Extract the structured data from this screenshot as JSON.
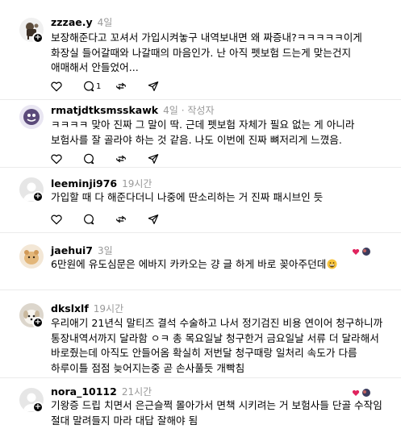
{
  "posts": [
    {
      "username": "zzzae.y",
      "time": "4일",
      "subtitle": "",
      "text": "보장해준다고 꼬셔서 가입시켜놓구 내역보내면 왜 짜증내?ㅋㅋㅋㅋㅋ이게 화장실 들어갈때와 나갈때의 마음인가. 난 아직 펫보험 드는게 맞는건지 애매해서 안들었어...",
      "reply_count": "1"
    },
    {
      "username": "rmatjdtksmsskawk",
      "time": "4일",
      "subtitle": "· 작성자",
      "text": "ㅋㅋㅋㅋ 맞아 진짜 그 말이 딱. 근데 펫보험 자체가 필요 없는 게 아니라 보험사를 잘 골라야 하는 것 같음. 나도 이번에 진짜 뼈저리게 느꼈음.",
      "reply_count": ""
    },
    {
      "username": "leeminji976",
      "time": "19시간",
      "subtitle": "",
      "text": "가입할 때 다 해준다더니 나중에 딴소리하는 거 진짜 패시브인 듯",
      "reply_count": ""
    },
    {
      "username": "jaehui7",
      "time": "3일",
      "subtitle": "",
      "text": "6만원에 유도심문은 에바지 카카오는 걍 글 하게 바로 꽂아주던데",
      "reply_count": ""
    },
    {
      "username": "dkslxlf",
      "time": "19시간",
      "subtitle": "",
      "text": "우리애기 21년식 말티즈 결석 수술하고 나서 정기검진 비용 연이어 청구하니까 통장내역서까지 달라함 ㅇㅋ 총 목요일날 청구한거 금요일날 서류 더 달라해서 바로줬는데 아직도 안들어옴 확실히 저번달 청구때랑 일처리 속도가 다름 하루이틀 점점 늦어지는중 곧 손사풀듯 개빡침",
      "reply_count": ""
    },
    {
      "username": "nora_10112",
      "time": "21시간",
      "subtitle": "",
      "text": "기왕증 드립 치면서 은근슬쩍 몰아가서 면책 시키려는 거 보험사들 단골 수작임 절대 말려들지 마라 대답 잘해야 됨",
      "reply_count": ""
    }
  ],
  "colors": {
    "text": "#000000",
    "muted": "#999999",
    "divider": "#ebebeb"
  },
  "icons": [
    "heart-icon",
    "comment-icon",
    "repost-icon",
    "share-icon",
    "follow-plus-icon",
    "grinning-emoji-icon"
  ]
}
